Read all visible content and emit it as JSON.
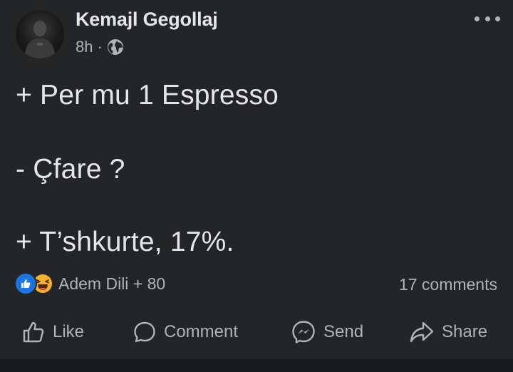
{
  "post": {
    "author": "Kemajl Gegollaj",
    "time": "8h",
    "separator": "·",
    "privacy_icon": "globe-icon",
    "more_icon": "more-options-icon",
    "lines": [
      "+ Per mu 1 Espresso",
      "- Çfare ?",
      "+ T’shkurte, 17%."
    ]
  },
  "reactions": {
    "icons": [
      "like-reaction-icon",
      "haha-reaction-icon"
    ],
    "summary": "Adem Dili + 80",
    "comments": "17 comments"
  },
  "actions": {
    "like": "Like",
    "comment": "Comment",
    "send": "Send",
    "share": "Share"
  },
  "colors": {
    "background": "#242526",
    "text_primary": "#e4e6eb",
    "text_secondary": "#b0b3b8",
    "like_blue": "#1b74e4",
    "haha_yellow": "#f7b125"
  }
}
